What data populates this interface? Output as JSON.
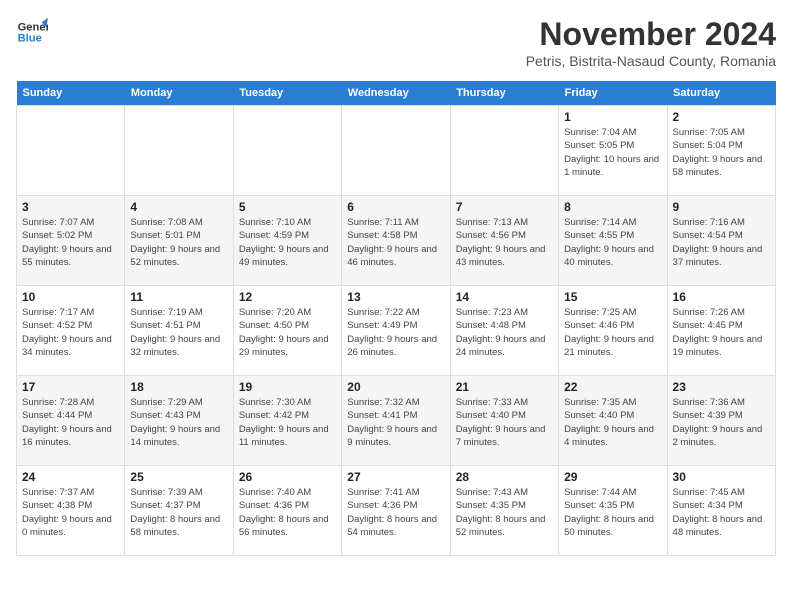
{
  "header": {
    "logo_line1": "General",
    "logo_line2": "Blue",
    "month_title": "November 2024",
    "subtitle": "Petris, Bistrita-Nasaud County, Romania"
  },
  "days_of_week": [
    "Sunday",
    "Monday",
    "Tuesday",
    "Wednesday",
    "Thursday",
    "Friday",
    "Saturday"
  ],
  "weeks": [
    [
      {
        "day": "",
        "info": ""
      },
      {
        "day": "",
        "info": ""
      },
      {
        "day": "",
        "info": ""
      },
      {
        "day": "",
        "info": ""
      },
      {
        "day": "",
        "info": ""
      },
      {
        "day": "1",
        "info": "Sunrise: 7:04 AM\nSunset: 5:05 PM\nDaylight: 10 hours and 1 minute."
      },
      {
        "day": "2",
        "info": "Sunrise: 7:05 AM\nSunset: 5:04 PM\nDaylight: 9 hours and 58 minutes."
      }
    ],
    [
      {
        "day": "3",
        "info": "Sunrise: 7:07 AM\nSunset: 5:02 PM\nDaylight: 9 hours and 55 minutes."
      },
      {
        "day": "4",
        "info": "Sunrise: 7:08 AM\nSunset: 5:01 PM\nDaylight: 9 hours and 52 minutes."
      },
      {
        "day": "5",
        "info": "Sunrise: 7:10 AM\nSunset: 4:59 PM\nDaylight: 9 hours and 49 minutes."
      },
      {
        "day": "6",
        "info": "Sunrise: 7:11 AM\nSunset: 4:58 PM\nDaylight: 9 hours and 46 minutes."
      },
      {
        "day": "7",
        "info": "Sunrise: 7:13 AM\nSunset: 4:56 PM\nDaylight: 9 hours and 43 minutes."
      },
      {
        "day": "8",
        "info": "Sunrise: 7:14 AM\nSunset: 4:55 PM\nDaylight: 9 hours and 40 minutes."
      },
      {
        "day": "9",
        "info": "Sunrise: 7:16 AM\nSunset: 4:54 PM\nDaylight: 9 hours and 37 minutes."
      }
    ],
    [
      {
        "day": "10",
        "info": "Sunrise: 7:17 AM\nSunset: 4:52 PM\nDaylight: 9 hours and 34 minutes."
      },
      {
        "day": "11",
        "info": "Sunrise: 7:19 AM\nSunset: 4:51 PM\nDaylight: 9 hours and 32 minutes."
      },
      {
        "day": "12",
        "info": "Sunrise: 7:20 AM\nSunset: 4:50 PM\nDaylight: 9 hours and 29 minutes."
      },
      {
        "day": "13",
        "info": "Sunrise: 7:22 AM\nSunset: 4:49 PM\nDaylight: 9 hours and 26 minutes."
      },
      {
        "day": "14",
        "info": "Sunrise: 7:23 AM\nSunset: 4:48 PM\nDaylight: 9 hours and 24 minutes."
      },
      {
        "day": "15",
        "info": "Sunrise: 7:25 AM\nSunset: 4:46 PM\nDaylight: 9 hours and 21 minutes."
      },
      {
        "day": "16",
        "info": "Sunrise: 7:26 AM\nSunset: 4:45 PM\nDaylight: 9 hours and 19 minutes."
      }
    ],
    [
      {
        "day": "17",
        "info": "Sunrise: 7:28 AM\nSunset: 4:44 PM\nDaylight: 9 hours and 16 minutes."
      },
      {
        "day": "18",
        "info": "Sunrise: 7:29 AM\nSunset: 4:43 PM\nDaylight: 9 hours and 14 minutes."
      },
      {
        "day": "19",
        "info": "Sunrise: 7:30 AM\nSunset: 4:42 PM\nDaylight: 9 hours and 11 minutes."
      },
      {
        "day": "20",
        "info": "Sunrise: 7:32 AM\nSunset: 4:41 PM\nDaylight: 9 hours and 9 minutes."
      },
      {
        "day": "21",
        "info": "Sunrise: 7:33 AM\nSunset: 4:40 PM\nDaylight: 9 hours and 7 minutes."
      },
      {
        "day": "22",
        "info": "Sunrise: 7:35 AM\nSunset: 4:40 PM\nDaylight: 9 hours and 4 minutes."
      },
      {
        "day": "23",
        "info": "Sunrise: 7:36 AM\nSunset: 4:39 PM\nDaylight: 9 hours and 2 minutes."
      }
    ],
    [
      {
        "day": "24",
        "info": "Sunrise: 7:37 AM\nSunset: 4:38 PM\nDaylight: 9 hours and 0 minutes."
      },
      {
        "day": "25",
        "info": "Sunrise: 7:39 AM\nSunset: 4:37 PM\nDaylight: 8 hours and 58 minutes."
      },
      {
        "day": "26",
        "info": "Sunrise: 7:40 AM\nSunset: 4:36 PM\nDaylight: 8 hours and 56 minutes."
      },
      {
        "day": "27",
        "info": "Sunrise: 7:41 AM\nSunset: 4:36 PM\nDaylight: 8 hours and 54 minutes."
      },
      {
        "day": "28",
        "info": "Sunrise: 7:43 AM\nSunset: 4:35 PM\nDaylight: 8 hours and 52 minutes."
      },
      {
        "day": "29",
        "info": "Sunrise: 7:44 AM\nSunset: 4:35 PM\nDaylight: 8 hours and 50 minutes."
      },
      {
        "day": "30",
        "info": "Sunrise: 7:45 AM\nSunset: 4:34 PM\nDaylight: 8 hours and 48 minutes."
      }
    ]
  ]
}
